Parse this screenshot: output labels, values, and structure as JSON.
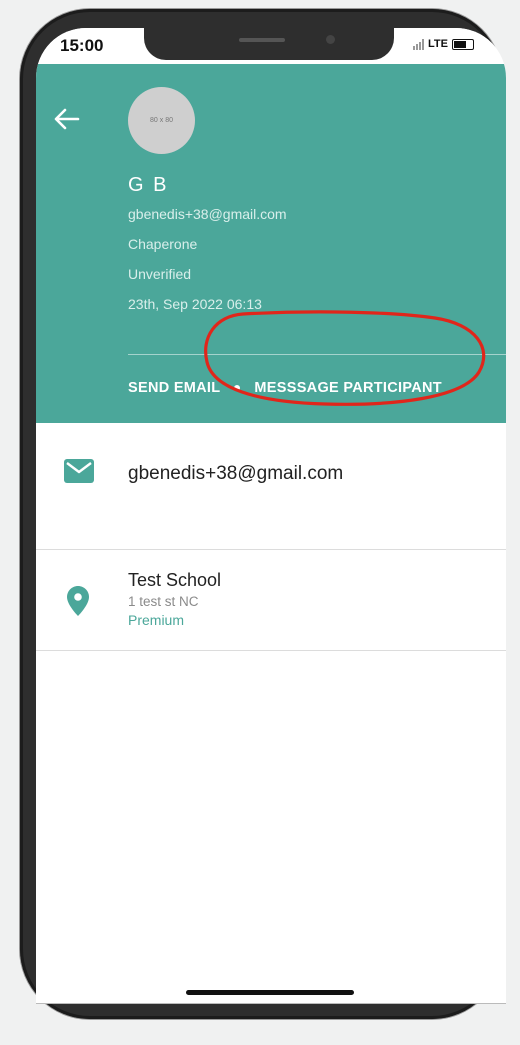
{
  "status_bar": {
    "time": "15:00",
    "network": "LTE"
  },
  "header": {
    "avatar_placeholder": "80 x 80",
    "name": "G B",
    "email": "gbenedis+38@gmail.com",
    "role": "Chaperone",
    "verification": "Unverified",
    "date": "23th, Sep 2022 06:13",
    "send_email_label": "SEND EMAIL",
    "message_label": "MESSSAGE PARTICIPANT"
  },
  "contact": {
    "email": "gbenedis+38@gmail.com"
  },
  "school": {
    "name": "Test School",
    "address": "1 test st  NC",
    "plan": "Premium"
  },
  "colors": {
    "primary": "#4ba79a",
    "annotation": "#e0261b"
  }
}
